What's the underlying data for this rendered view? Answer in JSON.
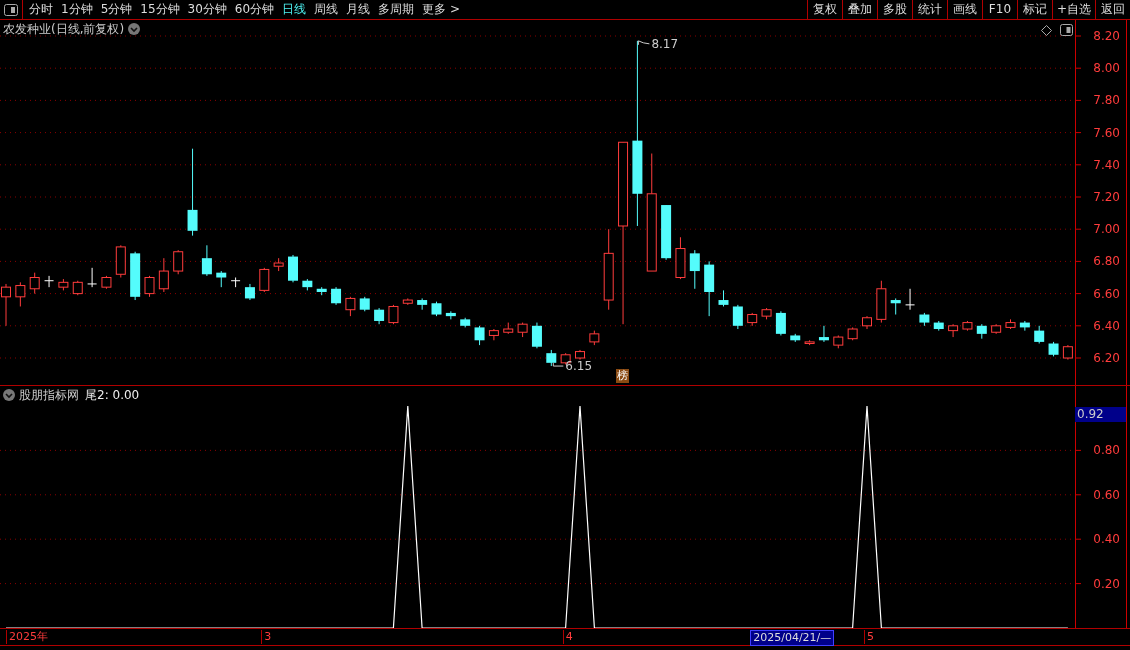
{
  "toolbar": {
    "periods": [
      {
        "label": "分时",
        "selected": false
      },
      {
        "label": "1分钟",
        "selected": false
      },
      {
        "label": "5分钟",
        "selected": false
      },
      {
        "label": "15分钟",
        "selected": false
      },
      {
        "label": "30分钟",
        "selected": false
      },
      {
        "label": "60分钟",
        "selected": false
      },
      {
        "label": "日线",
        "selected": true
      },
      {
        "label": "周线",
        "selected": false
      },
      {
        "label": "月线",
        "selected": false
      },
      {
        "label": "多周期",
        "selected": false
      },
      {
        "label": "更多 >",
        "selected": false
      }
    ],
    "buttons": [
      "复权",
      "叠加",
      "多股",
      "统计",
      "画线",
      "F10",
      "标记",
      "+自选",
      "返回"
    ]
  },
  "main_panel": {
    "title": "农发种业(日线,前复权)",
    "price_axis": [
      "8.20",
      "8.00",
      "7.80",
      "7.60",
      "7.40",
      "7.20",
      "7.00",
      "6.80",
      "6.60",
      "6.40",
      "6.20"
    ],
    "high_label": "8.17",
    "low_label": "6.15",
    "badge": "榜"
  },
  "indicator_panel": {
    "title": "股朋指标网",
    "legend": "尾2: 0.00",
    "cursor_value": "0.92",
    "chart_data": {
      "type": "line",
      "ylim": [
        0,
        1.09
      ],
      "grid": true,
      "yticks": [
        {
          "value": 0.2,
          "label": "0.20"
        },
        {
          "value": 0.4,
          "label": "0.40"
        },
        {
          "value": 0.6,
          "label": "0.60"
        },
        {
          "value": 0.8,
          "label": "0.80"
        }
      ],
      "values": [
        0,
        0,
        0,
        0,
        0,
        0,
        0,
        0,
        0,
        0,
        0,
        0,
        0,
        0,
        0,
        0,
        0,
        0,
        0,
        0,
        0,
        0,
        0,
        0,
        0,
        0,
        0,
        0,
        1,
        0,
        0,
        0,
        0,
        0,
        0,
        0,
        0,
        0,
        0,
        0,
        1,
        0,
        0,
        0,
        0,
        0,
        0,
        0,
        0,
        0,
        0,
        0,
        0,
        0,
        0,
        0,
        0,
        0,
        0,
        0,
        1,
        0,
        0,
        0,
        0,
        0,
        0,
        0,
        0,
        0,
        0,
        0,
        0,
        0,
        0
      ]
    }
  },
  "date_axis": {
    "labels": [
      "2025年",
      "3",
      "4",
      "5"
    ],
    "cursor_date": "2025/04/21/—"
  }
}
